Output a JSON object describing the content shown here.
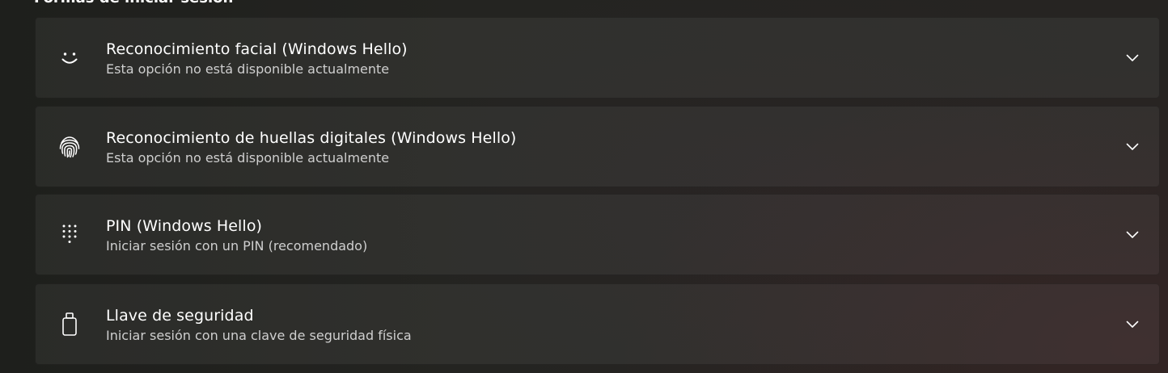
{
  "section": {
    "heading": "Formas de iniciar sesión"
  },
  "options": [
    {
      "title": "Reconocimiento facial (Windows Hello)",
      "subtitle": "Esta opción no está disponible actualmente",
      "icon": "face-icon"
    },
    {
      "title": "Reconocimiento de huellas digitales (Windows Hello)",
      "subtitle": "Esta opción no está disponible actualmente",
      "icon": "fingerprint-icon"
    },
    {
      "title": "PIN (Windows Hello)",
      "subtitle": "Iniciar sesión con un PIN (recomendado)",
      "icon": "keypad-icon"
    },
    {
      "title": "Llave de seguridad",
      "subtitle": "Iniciar sesión con una clave de seguridad física",
      "icon": "usb-key-icon"
    }
  ],
  "colors": {
    "card_bg": "#2c2c2b",
    "text_primary": "#ffffff",
    "text_secondary": "#cfcfcf"
  }
}
